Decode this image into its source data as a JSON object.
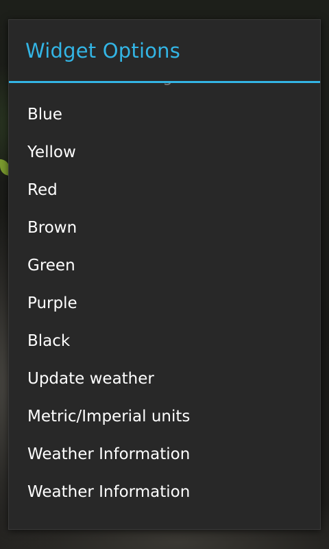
{
  "dialog": {
    "title": "Widget Options",
    "accent_color": "#33b5e5",
    "background_color": "#282828"
  },
  "options": {
    "items": [
      "Time Zone Settings",
      "Blue",
      "Yellow",
      "Red",
      "Brown",
      "Green",
      "Purple",
      "Black",
      "Update weather",
      "Metric/Imperial units",
      "Weather Information",
      "Weather Information"
    ]
  }
}
